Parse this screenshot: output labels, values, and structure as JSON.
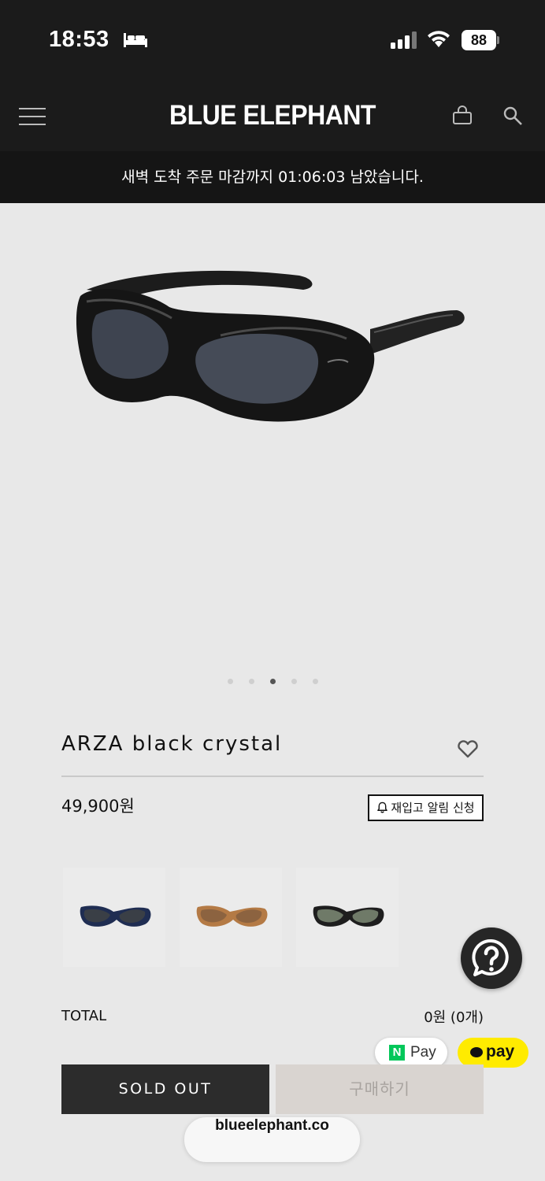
{
  "status_bar": {
    "time": "18:53",
    "battery": "88",
    "icons": [
      "bed-icon",
      "signal-icon",
      "wifi-icon",
      "battery-icon"
    ]
  },
  "header": {
    "brand": "BLUE ELEPHANT",
    "icons": [
      "menu-icon",
      "shopping-bag-icon",
      "search-icon"
    ]
  },
  "notice": {
    "text": "새벽 도착 주문 마감까지 01:06:03 남았습니다."
  },
  "gallery": {
    "slide_count": 5,
    "active_index": 2
  },
  "product": {
    "name": "ARZA black crystal",
    "price": "49,900원",
    "restock_label": "재입고 알림 신청",
    "color_options": [
      {
        "frame": "#1f2d52",
        "lens": "#3a3f46"
      },
      {
        "frame": "#b47a45",
        "lens": "#8c6340"
      },
      {
        "frame": "#1e1e1e",
        "lens": "#6f7a68"
      }
    ]
  },
  "summary": {
    "total_label": "TOTAL",
    "total_value": "0원 (0개)"
  },
  "payments": {
    "npay_logo": "N",
    "npay_label": "Pay",
    "kakaopay_label": "pay"
  },
  "actions": {
    "sold_out": "SOLD OUT",
    "buy": "구매하기"
  },
  "browser": {
    "url": "blueelephant.co"
  },
  "colors": {
    "header_bg": "#1b1b1b",
    "page_bg": "#e8e8e8",
    "npay_green": "#03c75a",
    "kakao_yellow": "#ffeb00"
  }
}
